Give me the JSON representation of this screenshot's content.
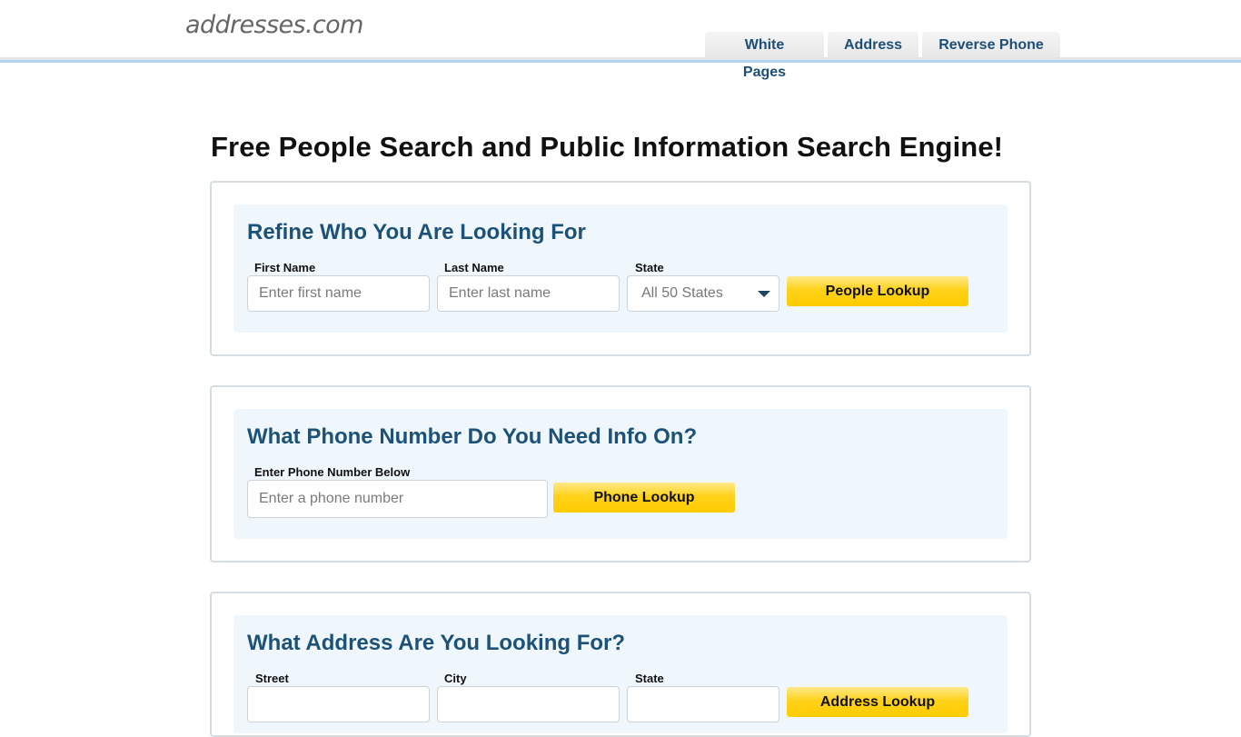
{
  "site": {
    "logo": "addresses.com"
  },
  "nav": {
    "tabs": [
      {
        "label": "White Pages"
      },
      {
        "label": "Address"
      },
      {
        "label": "Reverse Phone"
      }
    ]
  },
  "page_title": "Free People Search and Public Information Search Engine!",
  "people_search": {
    "title": "Refine Who You Are Looking For",
    "first_name": {
      "label": "First Name",
      "placeholder": "Enter first name",
      "value": ""
    },
    "last_name": {
      "label": "Last Name",
      "placeholder": "Enter last name",
      "value": ""
    },
    "state": {
      "label": "State",
      "selected": "All 50 States"
    },
    "button": "People Lookup"
  },
  "phone_search": {
    "title": "What Phone Number Do You Need Info On?",
    "phone": {
      "label": "Enter Phone Number Below",
      "placeholder": "Enter a phone number",
      "value": ""
    },
    "button": "Phone Lookup"
  },
  "address_search": {
    "title": "What Address Are You Looking For?",
    "street": {
      "label": "Street"
    },
    "city": {
      "label": "City"
    },
    "state": {
      "label": "State"
    },
    "button": "Address Lookup"
  },
  "colors": {
    "accent_blue": "#1c5178",
    "button_yellow": "#ffcc00",
    "panel_bg": "#f0f7fc",
    "header_line": "#b3d4ec"
  }
}
